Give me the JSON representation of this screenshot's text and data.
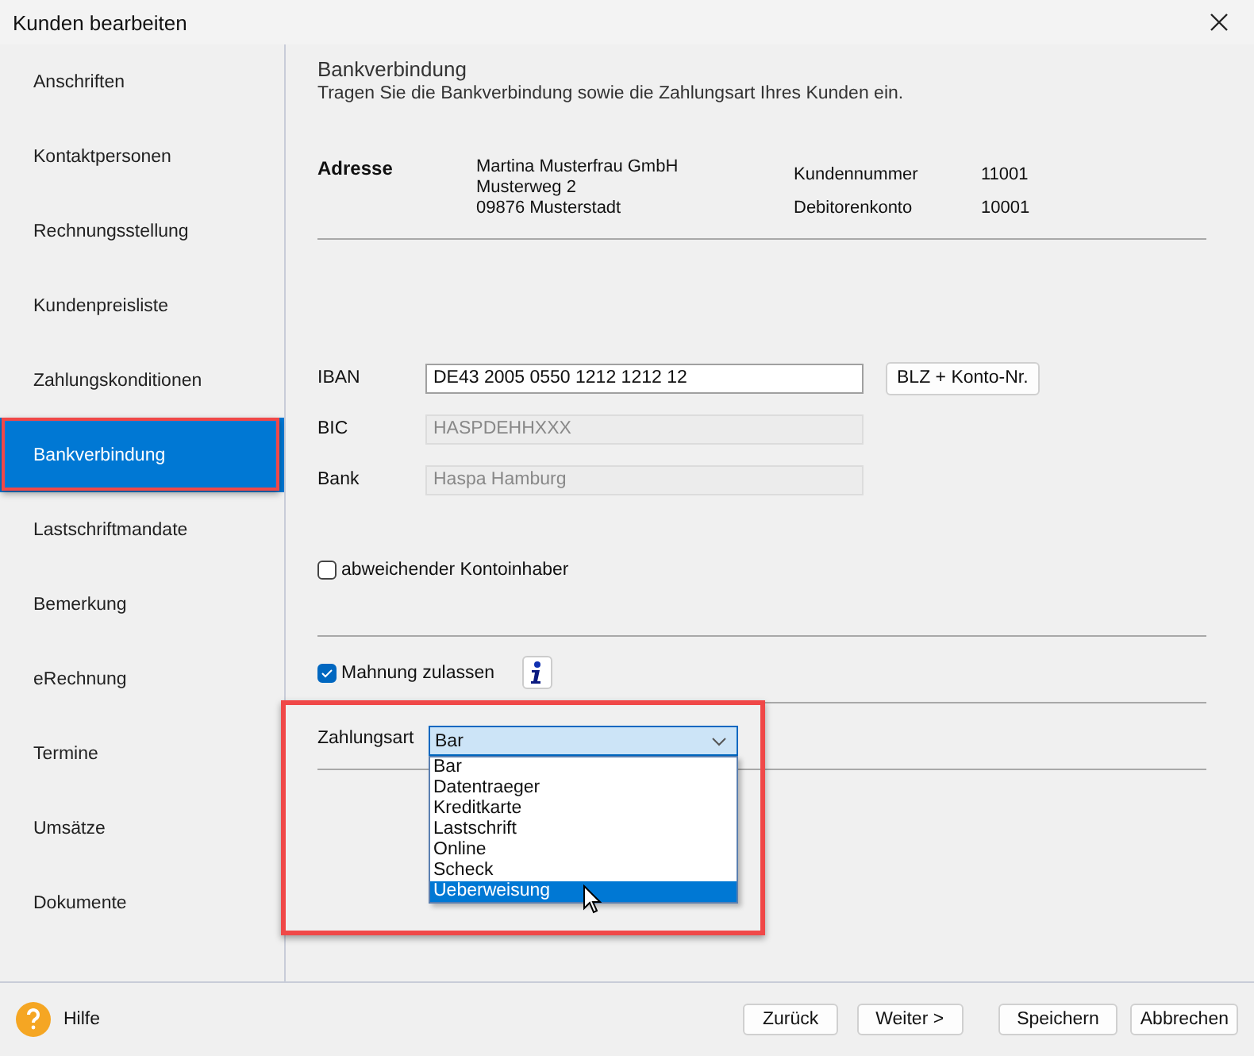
{
  "window": {
    "title": "Kunden bearbeiten"
  },
  "sidebar": {
    "items": [
      {
        "label": "Anschriften",
        "selected": false,
        "highlighted": false
      },
      {
        "label": "Kontaktpersonen",
        "selected": false,
        "highlighted": false
      },
      {
        "label": "Rechnungsstellung",
        "selected": false,
        "highlighted": false
      },
      {
        "label": "Kundenpreisliste",
        "selected": false,
        "highlighted": false
      },
      {
        "label": "Zahlungskonditionen",
        "selected": false,
        "highlighted": false
      },
      {
        "label": "Bankverbindung",
        "selected": true,
        "highlighted": true
      },
      {
        "label": "Lastschriftmandate",
        "selected": false,
        "highlighted": false
      },
      {
        "label": "Bemerkung",
        "selected": false,
        "highlighted": false
      },
      {
        "label": "eRechnung",
        "selected": false,
        "highlighted": false
      },
      {
        "label": "Termine",
        "selected": false,
        "highlighted": false
      },
      {
        "label": "Umsätze",
        "selected": false,
        "highlighted": false
      },
      {
        "label": "Dokumente",
        "selected": false,
        "highlighted": false
      }
    ]
  },
  "section": {
    "title": "Bankverbindung",
    "subtitle": "Tragen Sie die Bankverbindung sowie die Zahlungsart Ihres Kunden ein."
  },
  "address": {
    "label": "Adresse",
    "lines": [
      "Martina Musterfrau GmbH",
      "Musterweg 2",
      "09876 Musterstadt"
    ],
    "fields": [
      {
        "label": "Kundennummer",
        "value": "11001"
      },
      {
        "label": "Debitorenkonto",
        "value": "10001"
      }
    ]
  },
  "bank_fields": [
    {
      "label": "IBAN",
      "value": "DE43 2005 0550 1212 1212 12",
      "disabled": false
    },
    {
      "label": "BIC",
      "value": "HASPDEHHXXX",
      "disabled": true
    },
    {
      "label": "Bank",
      "value": "Haspa Hamburg",
      "disabled": true
    }
  ],
  "iban_button": "BLZ + Konto-Nr.",
  "different_holder": {
    "label": "abweichender Kontoinhaber",
    "checked": false
  },
  "reminder": {
    "label": "Mahnung zulassen",
    "checked": true
  },
  "payment": {
    "label": "Zahlungsart",
    "value": "Bar",
    "expanded": true,
    "highlighted": true,
    "options": [
      {
        "label": "Bar",
        "highlighted": false
      },
      {
        "label": "Datentraeger",
        "highlighted": false
      },
      {
        "label": "Kreditkarte",
        "highlighted": false
      },
      {
        "label": "Lastschrift",
        "highlighted": false
      },
      {
        "label": "Online",
        "highlighted": false
      },
      {
        "label": "Scheck",
        "highlighted": false
      },
      {
        "label": "Ueberweisung",
        "highlighted": true
      }
    ]
  },
  "footer": {
    "help": "Hilfe",
    "buttons": [
      "Zurück",
      "Weiter >",
      "Speichern",
      "Abbrechen"
    ]
  }
}
